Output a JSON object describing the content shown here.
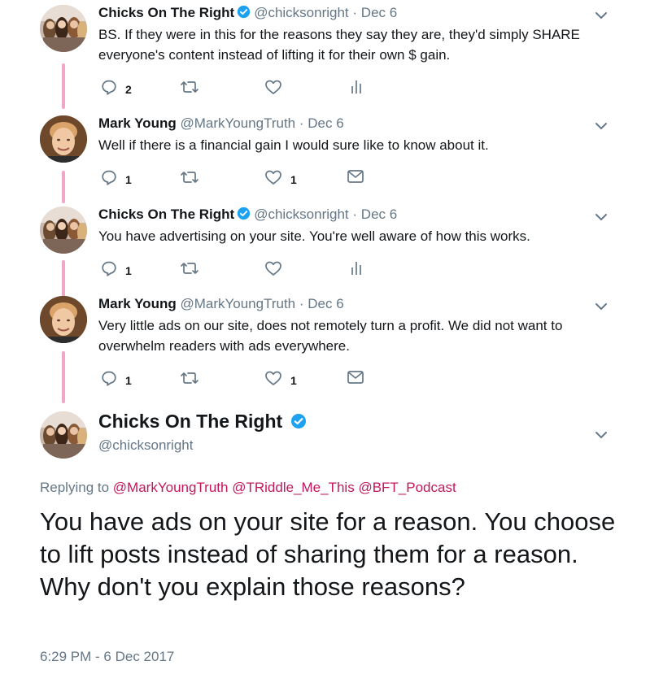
{
  "tweets": [
    {
      "name": "Chicks On The Right",
      "handle": "@chicksonright",
      "dot": "·",
      "date": "Dec 6",
      "text": "BS.  If they were in this for the reasons they say they are, they'd simply SHARE everyone's content instead of lifting it for their own $ gain.",
      "reply_count": "2",
      "like_count": "",
      "avatar": "chicks-avatar",
      "last_action": "analytics-icon"
    },
    {
      "name": "Mark Young",
      "handle": "@MarkYoungTruth",
      "dot": "·",
      "date": "Dec 6",
      "text": "Well if there is a financial gain I would sure like to know about it.",
      "reply_count": "1",
      "like_count": "1",
      "avatar": "mark-avatar",
      "last_action": "mail-icon"
    },
    {
      "name": "Chicks On The Right",
      "handle": "@chicksonright",
      "dot": "·",
      "date": "Dec 6",
      "text": "You have advertising on your site.  You're well aware of how this works.",
      "reply_count": "1",
      "like_count": "",
      "avatar": "chicks-avatar",
      "last_action": "analytics-icon"
    },
    {
      "name": "Mark Young",
      "handle": "@MarkYoungTruth",
      "dot": "·",
      "date": "Dec 6",
      "text": "Very little ads on our site, does not remotely turn a profit. We did not want to overwhelm readers with ads everywhere.",
      "reply_count": "1",
      "like_count": "1",
      "avatar": "mark-avatar",
      "last_action": "mail-icon"
    }
  ],
  "main_tweet": {
    "name": "Chicks On The Right",
    "handle": "@chicksonright",
    "replying_to_label": "Replying to",
    "mentions": [
      "@MarkYoungTruth",
      "@TRiddle_Me_This",
      "@BFT_Podcast"
    ],
    "text": "You have ads on your site for a reason.  You choose to lift posts instead of sharing  them for a reason.  Why don't you explain those reasons?",
    "timestamp": "6:29 PM - 6 Dec 2017"
  },
  "colors": {
    "thread_line": "#f1a8c6",
    "verified": "#1da1f2",
    "muted": "#657786",
    "mention": "#c2185b"
  }
}
